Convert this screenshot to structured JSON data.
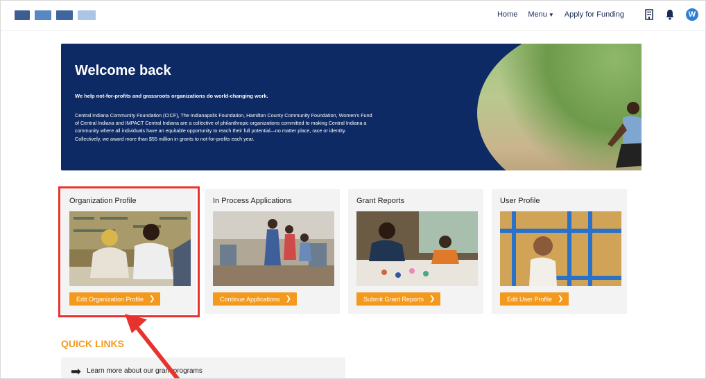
{
  "header": {
    "nav": {
      "home": "Home",
      "menu": "Menu",
      "apply": "Apply for Funding"
    },
    "avatar_initial": "W"
  },
  "hero": {
    "title": "Welcome back",
    "tagline": "We help not-for-profits and grassroots organizations do world-changing work.",
    "body": "Central Indiana Community Foundation (CICF), The Indianapolis Foundation, Hamilton County Community Foundation, Women's Fund of Central Indiana and IMPACT Central Indiana are a collective of philanthropic organizations committed to making Central Indiana a community where all individuals have an equitable opportunity to reach their full potential—no matter place, race or identity. Collectively, we award more than $55 million in grants to not-for-profits each year."
  },
  "cards": [
    {
      "title": "Organization Profile",
      "button": "Edit Organization Profile"
    },
    {
      "title": "In Process Applications",
      "button": "Continue Applications"
    },
    {
      "title": "Grant Reports",
      "button": "Submit Grant Reports"
    },
    {
      "title": "User Profile",
      "button": "Edit User Profile"
    }
  ],
  "quick_links": {
    "title": "QUICK LINKS",
    "items": [
      {
        "label": "Learn more about our grant programs"
      }
    ]
  },
  "colors": {
    "accent_orange": "#f39a1e",
    "hero_navy": "#0e2a64",
    "highlight_red": "#e8322e",
    "avatar_blue": "#2f7fd6"
  },
  "icons": [
    "building-icon",
    "bell-icon",
    "chevron-right-icon",
    "arrow-right-icon"
  ]
}
